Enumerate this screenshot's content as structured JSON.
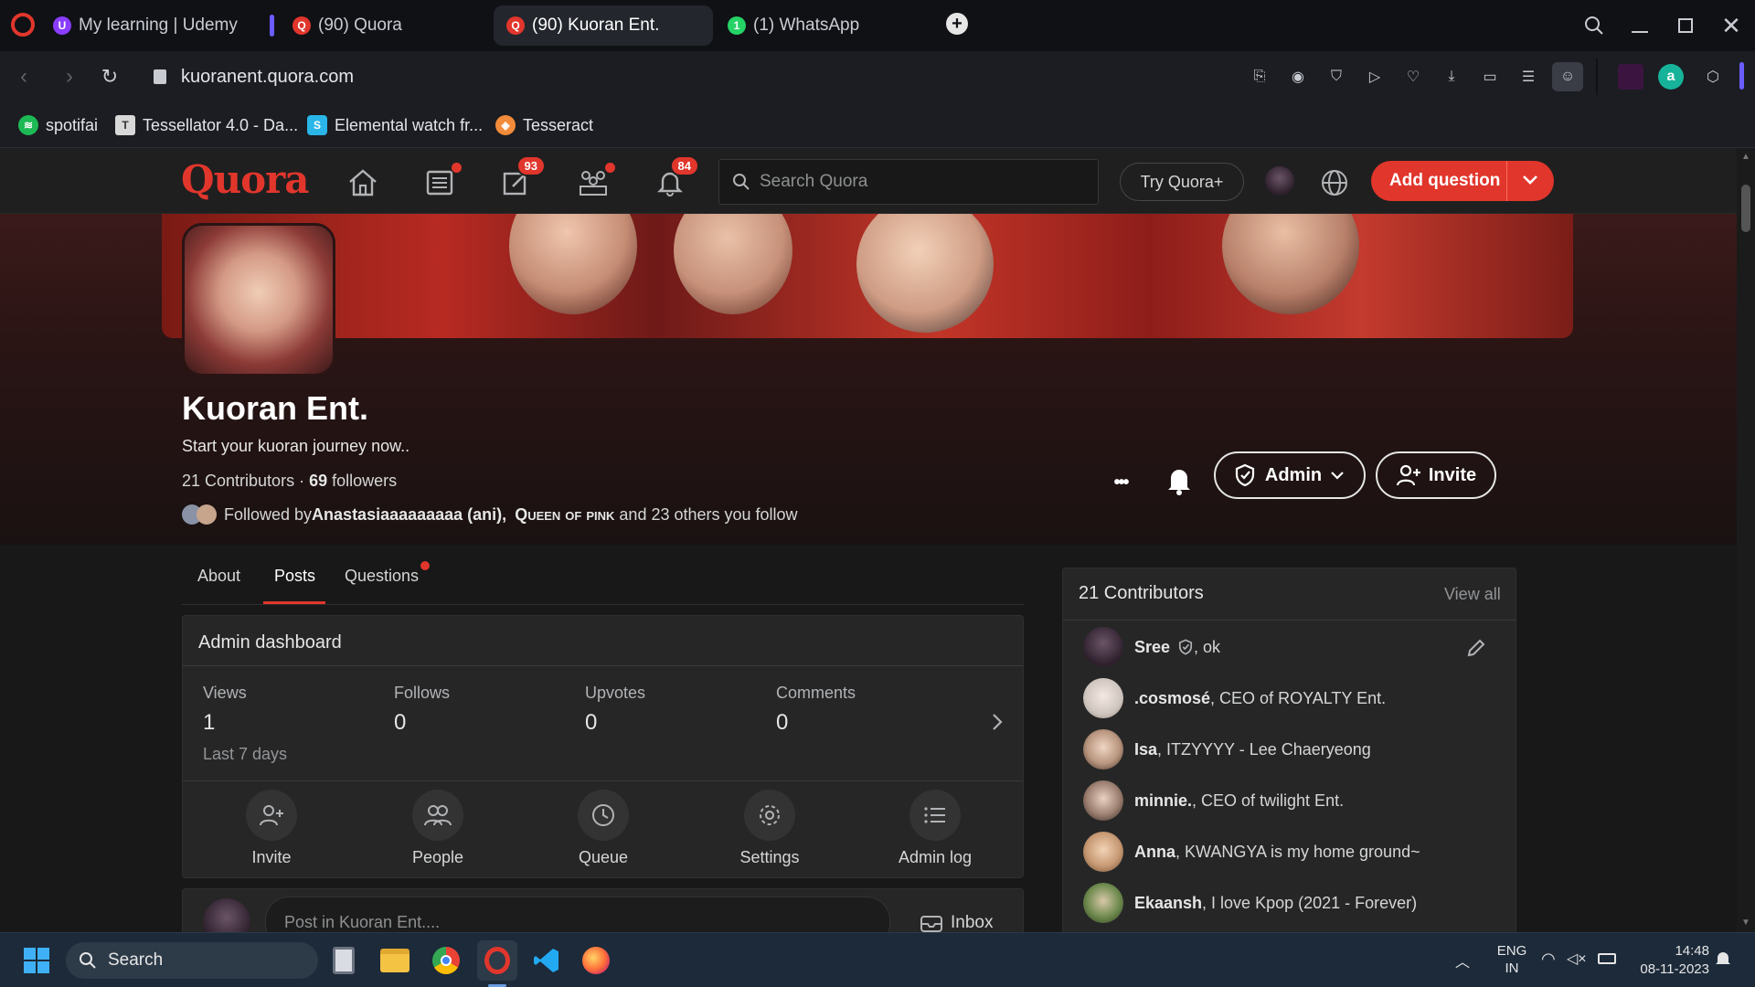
{
  "browser": {
    "tabs": [
      {
        "label": "My learning | Udemy",
        "icon": "udemy-icon"
      },
      {
        "label": "(90) Quora",
        "icon": "quora-icon"
      },
      {
        "label": "(90) Kuoran Ent.",
        "icon": "quora-icon",
        "active": true
      },
      {
        "label": "(1) WhatsApp",
        "icon": "whatsapp-icon"
      }
    ],
    "new_tab": "+",
    "url": "kuoranent.quora.com",
    "bookmarks": [
      {
        "label": "spotifai",
        "icon": "spotify-icon"
      },
      {
        "label": "Tessellator 4.0 - Da...",
        "icon": "tessellator-icon"
      },
      {
        "label": "Elemental watch fr...",
        "icon": "elemental-icon"
      },
      {
        "label": "Tesseract",
        "icon": "tesseract-icon"
      }
    ]
  },
  "quora": {
    "logo": "Quora",
    "notif_badges": {
      "answer": "93",
      "bell": "84"
    },
    "search_placeholder": "Search Quora",
    "try_plus": "Try Quora+",
    "add_question": "Add question"
  },
  "space": {
    "name": "Kuoran Ent.",
    "tagline": "Start your kuoran journey now..",
    "contributors_text": "21 Contributors · ",
    "followers_count": "69",
    "followers_word": " followers",
    "followed_by_prefix": "Followed by ",
    "followed_names": "Anastasiaaaaaaaaa (ani), ",
    "followed_name2": "Queen of pink",
    "followed_suffix": " and 23 others you follow",
    "admin_label": "Admin",
    "invite_label": "Invite",
    "more_label": "•••"
  },
  "page_tabs": [
    "About",
    "Posts",
    "Questions"
  ],
  "dashboard": {
    "title": "Admin dashboard",
    "stats": [
      {
        "label": "Views",
        "value": "1"
      },
      {
        "label": "Follows",
        "value": "0"
      },
      {
        "label": "Upvotes",
        "value": "0"
      },
      {
        "label": "Comments",
        "value": "0"
      }
    ],
    "period": "Last 7 days",
    "actions": [
      "Invite",
      "People",
      "Queue",
      "Settings",
      "Admin log"
    ]
  },
  "post_box": {
    "placeholder": "Post in Kuoran Ent....",
    "inbox": "Inbox"
  },
  "contributors": {
    "title": "21 Contributors",
    "view_all": "View all",
    "list": [
      {
        "name": "Sree",
        "desc": ", ok"
      },
      {
        "name": ".cosmosé",
        "desc": ", CEO of ROYALTY Ent."
      },
      {
        "name": "Isa",
        "desc": ", ITZYYYY - Lee Chaeryeong"
      },
      {
        "name": "minnie.",
        "desc": ", CEO of twilight Ent."
      },
      {
        "name": "Anna",
        "desc": ", KWANGYA is my home ground~"
      },
      {
        "name": "Ekaansh",
        "desc": ", I love Kpop (2021 - Forever)"
      }
    ]
  },
  "taskbar": {
    "search": "Search",
    "lang1": "ENG",
    "lang2": "IN",
    "time": "14:48",
    "date": "08-11-2023"
  },
  "colors": {
    "quora_red": "#e1362c",
    "bg": "#181818",
    "card": "#262626"
  }
}
